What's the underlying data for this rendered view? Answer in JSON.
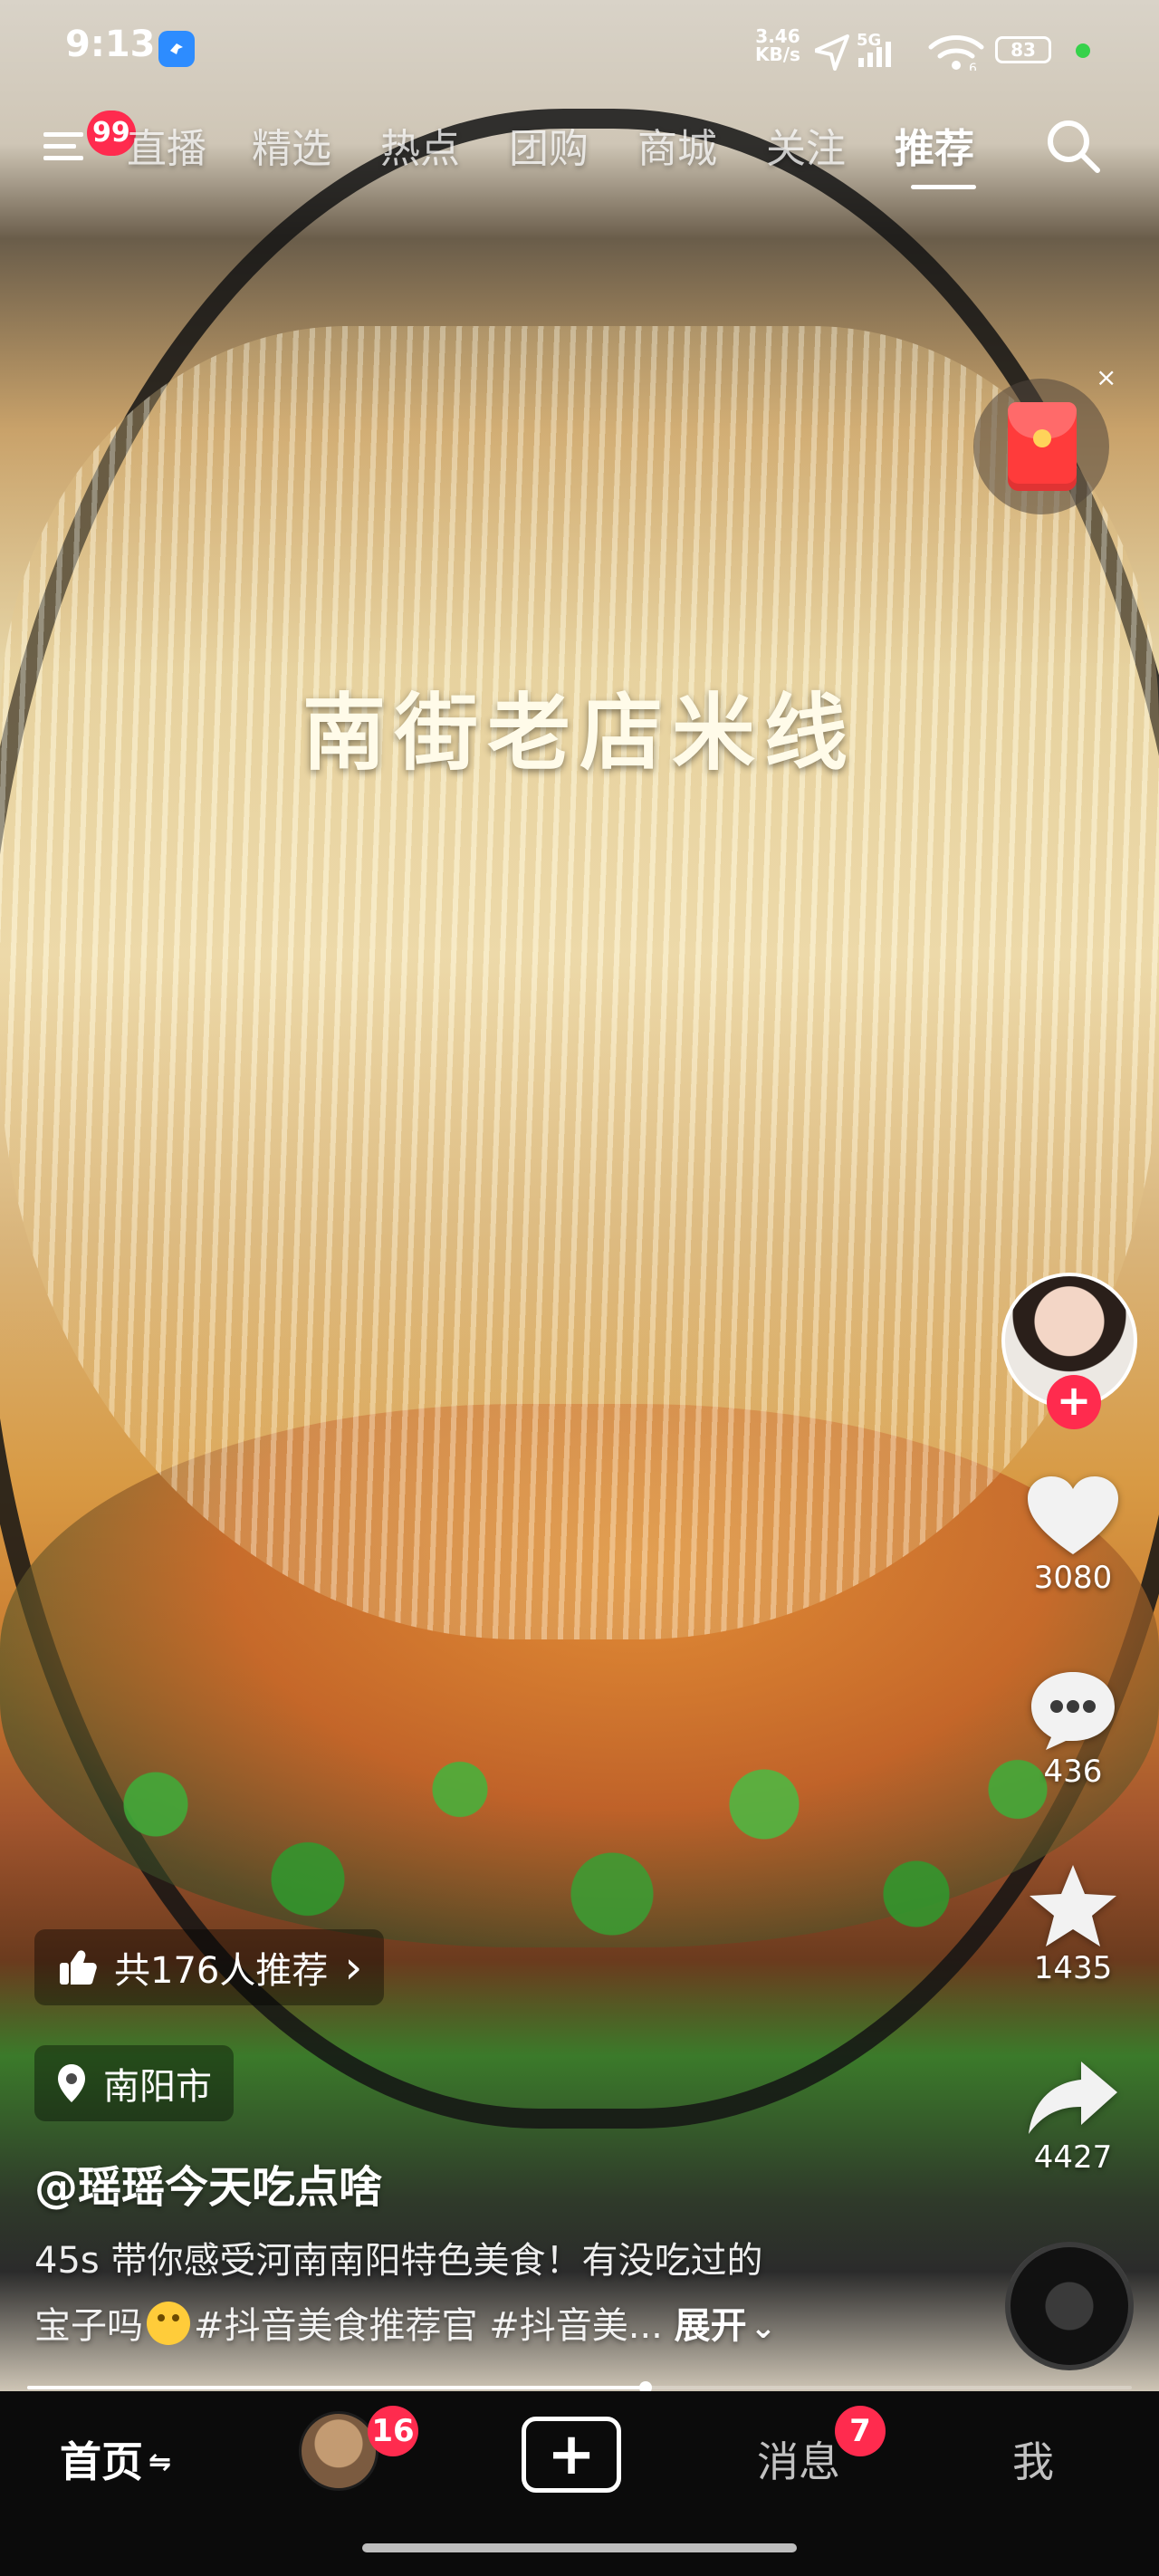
{
  "status_bar": {
    "time": "9:13",
    "net_speed_value": "3.46",
    "net_speed_unit": "KB/s",
    "signal_label": "5G",
    "battery": "83"
  },
  "top_nav": {
    "menu_badge": "99",
    "tabs": [
      {
        "label": "直播"
      },
      {
        "label": "精选"
      },
      {
        "label": "热点"
      },
      {
        "label": "团购"
      },
      {
        "label": "商城"
      },
      {
        "label": "关注"
      },
      {
        "label": "推荐"
      }
    ],
    "active_tab": "推荐"
  },
  "video": {
    "overlay_title": "南街老店米线"
  },
  "redpack": {
    "close_glyph": "×"
  },
  "actions": {
    "follow_glyph": "+",
    "likes": "3080",
    "comments": "436",
    "favorites": "1435",
    "shares": "4427"
  },
  "recommend_chip": {
    "label": "共176人推荐",
    "chevron": "›"
  },
  "location_chip": {
    "label": "南阳市"
  },
  "author": "@瑶瑶今天吃点啥",
  "description": {
    "line1": "45s 带你感受河南南阳特色美食！有没吃过的",
    "line2_before_emoji": "宝子吗",
    "line2_after_emoji": "#抖音美食推荐官 #抖音美...",
    "expand": "展开",
    "expand_chevron": "⌄"
  },
  "progress": {
    "played_fraction": 0.56
  },
  "bottom_nav": {
    "home": "首页",
    "home_refresh_glyph": "⇋",
    "friends_badge": "16",
    "create_glyph": "+",
    "messages": "消息",
    "messages_badge": "7",
    "me": "我"
  },
  "colors": {
    "accent_red": "#ff2b4e",
    "battery_dot": "#36d24b"
  }
}
